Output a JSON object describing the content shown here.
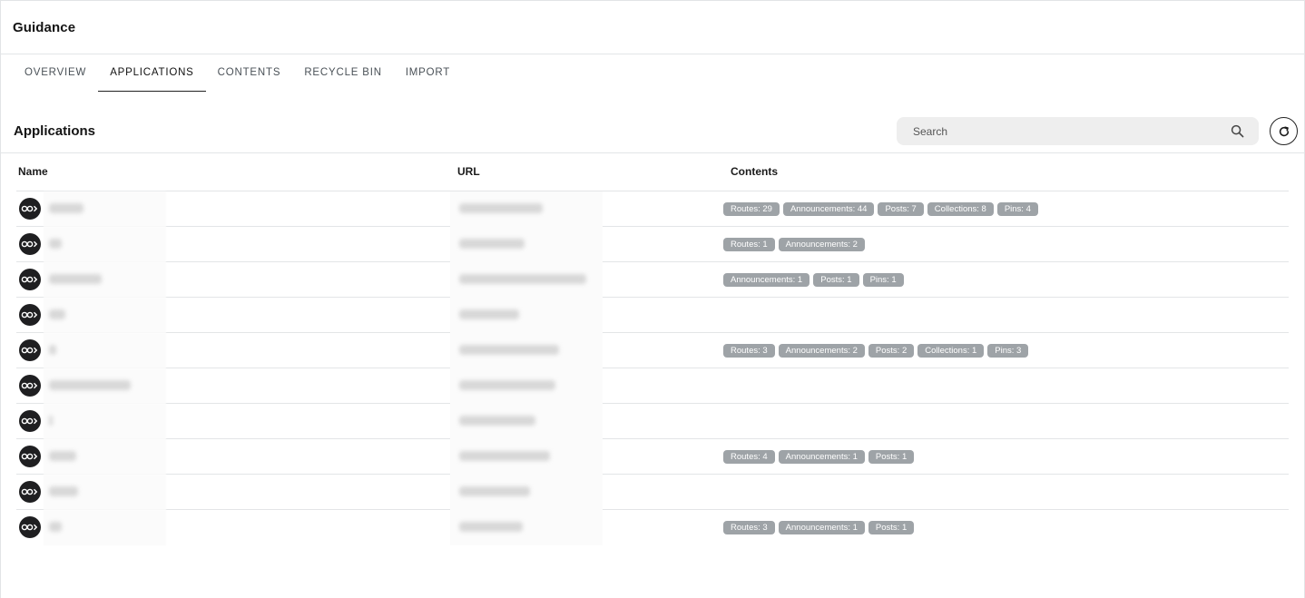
{
  "header": {
    "title": "Guidance"
  },
  "tabs": [
    {
      "label": "OVERVIEW",
      "active": false
    },
    {
      "label": "APPLICATIONS",
      "active": true
    },
    {
      "label": "CONTENTS",
      "active": false
    },
    {
      "label": "RECYCLE BIN",
      "active": false
    },
    {
      "label": "IMPORT",
      "active": false
    }
  ],
  "section": {
    "title": "Applications"
  },
  "search": {
    "placeholder": "Search",
    "value": ""
  },
  "table": {
    "columns": {
      "name": "Name",
      "url": "URL",
      "contents": "Contents"
    },
    "rows": [
      {
        "chips": [
          "Routes: 29",
          "Announcements: 44",
          "Posts: 7",
          "Collections: 8",
          "Pins: 4"
        ]
      },
      {
        "chips": [
          "Routes: 1",
          "Announcements: 2"
        ]
      },
      {
        "chips": [
          "Announcements: 1",
          "Posts: 1",
          "Pins: 1"
        ]
      },
      {
        "chips": []
      },
      {
        "chips": [
          "Routes: 3",
          "Announcements: 2",
          "Posts: 2",
          "Collections: 1",
          "Pins: 3"
        ]
      },
      {
        "chips": []
      },
      {
        "chips": []
      },
      {
        "chips": [
          "Routes: 4",
          "Announcements: 1",
          "Posts: 1"
        ]
      },
      {
        "chips": []
      },
      {
        "chips": [
          "Routes: 3",
          "Announcements: 1",
          "Posts: 1"
        ]
      }
    ]
  },
  "colors": {
    "chip_bg": "#9ea3a7",
    "avatar_bg": "#1f1f21",
    "search_bg": "#eeeeee"
  },
  "icons": {
    "search": "search-icon",
    "refresh": "refresh-icon",
    "avatar": "app-logo-icon"
  }
}
